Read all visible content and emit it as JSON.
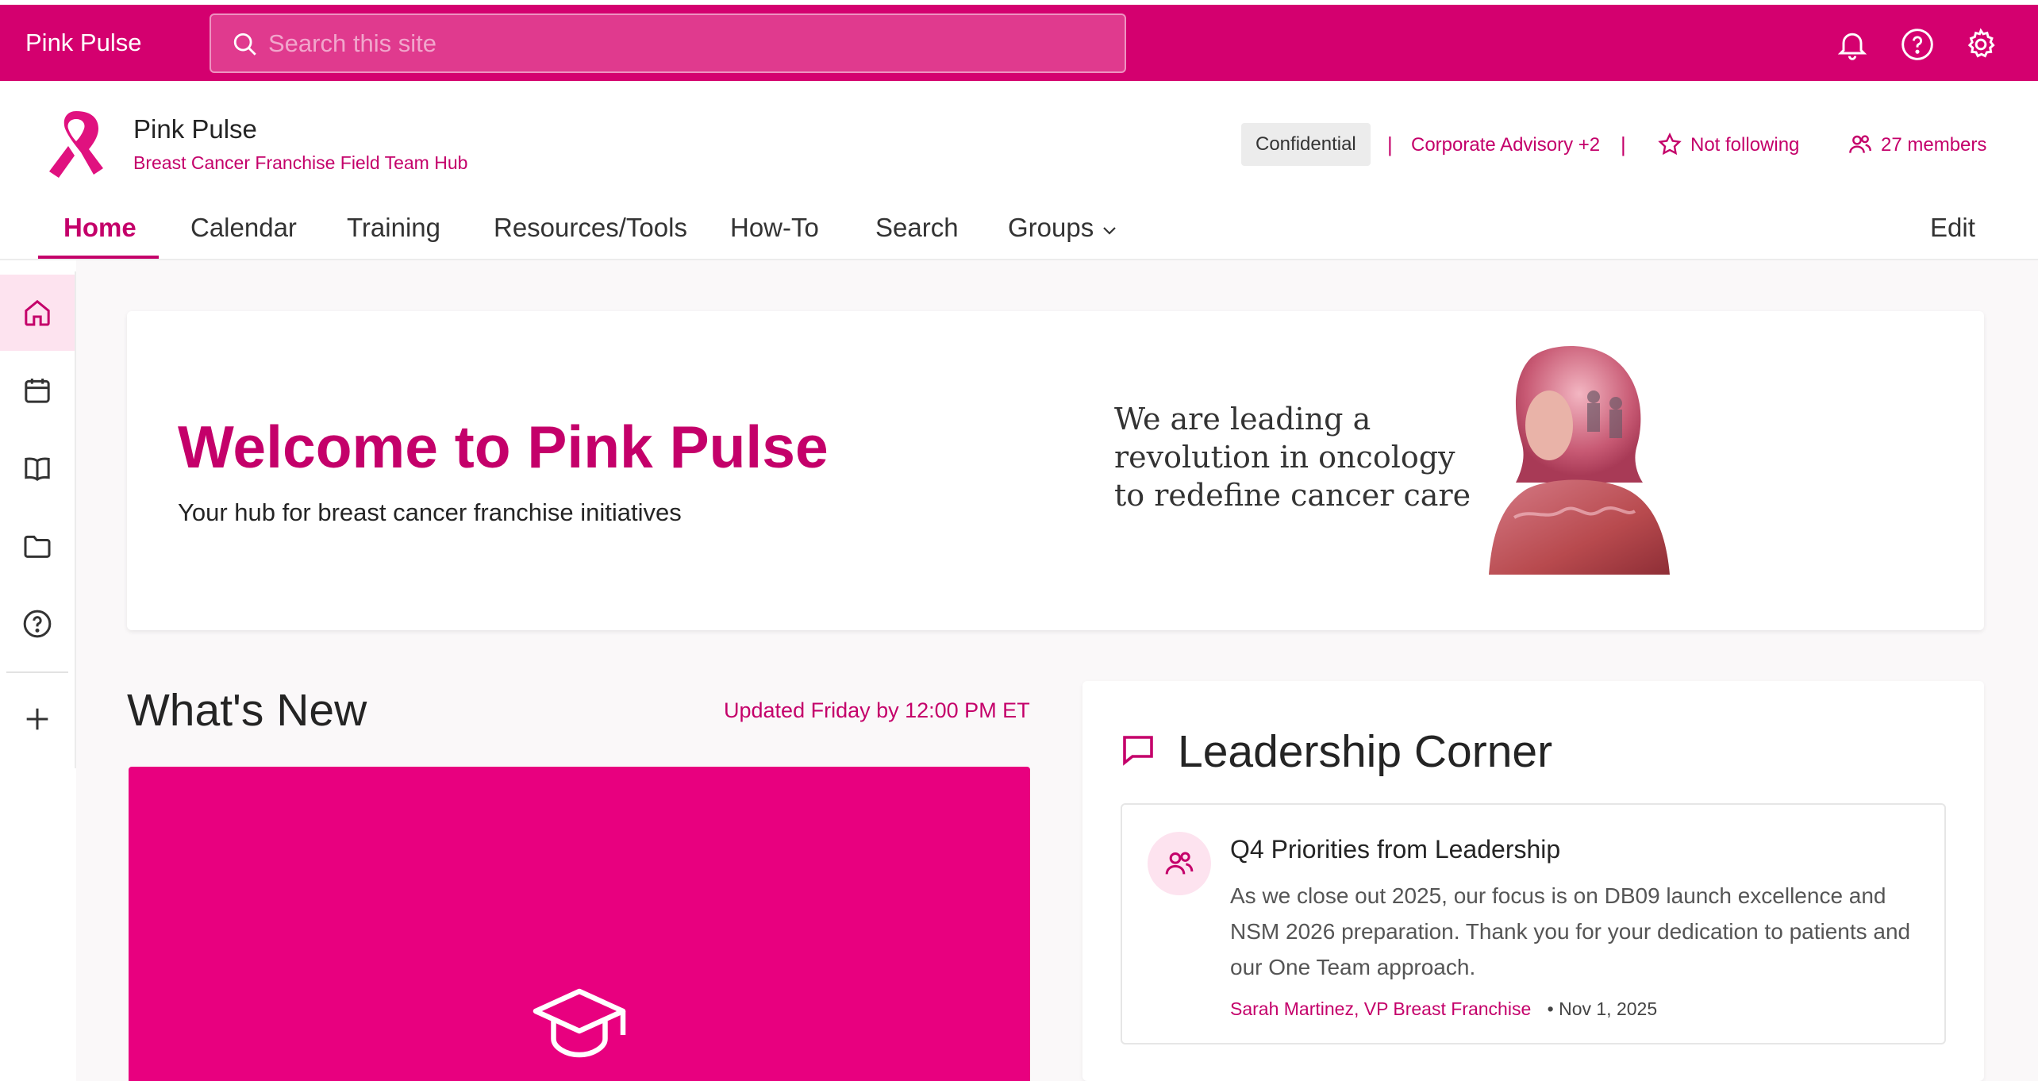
{
  "suite": {
    "title": "Pink Pulse",
    "search_placeholder": "Search this site",
    "icons": [
      "bell-icon",
      "help-icon",
      "gear-icon"
    ]
  },
  "site": {
    "name": "Pink Pulse",
    "subtitle": "Breast Cancer Franchise Field Team Hub",
    "confidential_label": "Confidential",
    "advisory_link": "Corporate Advisory +2",
    "follow_label": "Not following",
    "members_label": "27 members"
  },
  "nav": {
    "items": [
      "Home",
      "Calendar",
      "Training",
      "Resources/Tools",
      "How-To",
      "Search",
      "Groups"
    ],
    "edit_label": "Edit"
  },
  "rail": {
    "icons": [
      "home-icon",
      "calendar-icon",
      "book-icon",
      "folder-icon",
      "help-icon",
      "plus-icon"
    ]
  },
  "hero": {
    "title": "Welcome to Pink Pulse",
    "subtitle": "Your hub for breast cancer franchise initiatives",
    "quote_line1": "We are leading a",
    "quote_line2": "revolution in oncology",
    "quote_line3": "to redefine cancer care"
  },
  "whats_new": {
    "title": "What's New",
    "updated": "Updated Friday by 12:00 PM ET"
  },
  "leadership": {
    "title": "Leadership Corner",
    "post_title": "Q4 Priorities from Leadership",
    "post_body": "As we close out 2025, our focus is on DB09 launch excellence and NSM 2026 preparation. Thank you for your dedication to patients and our One Team approach.",
    "author": "Sarah Martinez, VP Breast Franchise",
    "date": "• Nov 1, 2025"
  },
  "colors": {
    "brand": "#d4006f",
    "accent_text": "#c4006a",
    "card_fill": "#e8007f"
  }
}
